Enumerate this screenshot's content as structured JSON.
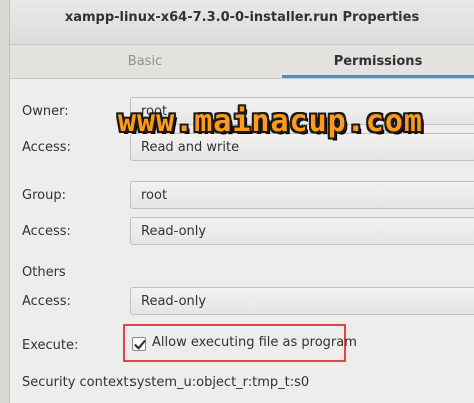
{
  "window": {
    "title": "xampp-linux-x64-7.3.0-0-installer.run Properties"
  },
  "tabs": [
    {
      "label": "Basic",
      "active": false
    },
    {
      "label": "Permissions",
      "active": true
    }
  ],
  "permissions": {
    "owner_label": "Owner:",
    "owner_value": "root",
    "owner_access_label": "Access:",
    "owner_access_value": "Read and write",
    "group_label": "Group:",
    "group_value": "root",
    "group_access_label": "Access:",
    "group_access_value": "Read-only",
    "others_label": "Others",
    "others_access_label": "Access:",
    "others_access_value": "Read-only",
    "execute_label": "Execute:",
    "execute_checkbox_label": "Allow executing file as program",
    "execute_checked": true,
    "security_context_label": "Security context:",
    "security_context_value": "system_u:object_r:tmp_t:s0"
  },
  "overlay": {
    "watermark_text": "www.mainacup.com"
  },
  "colors": {
    "accent": "#4a90d9",
    "highlight_border": "#e04646",
    "watermark": "#ff9a1a"
  }
}
